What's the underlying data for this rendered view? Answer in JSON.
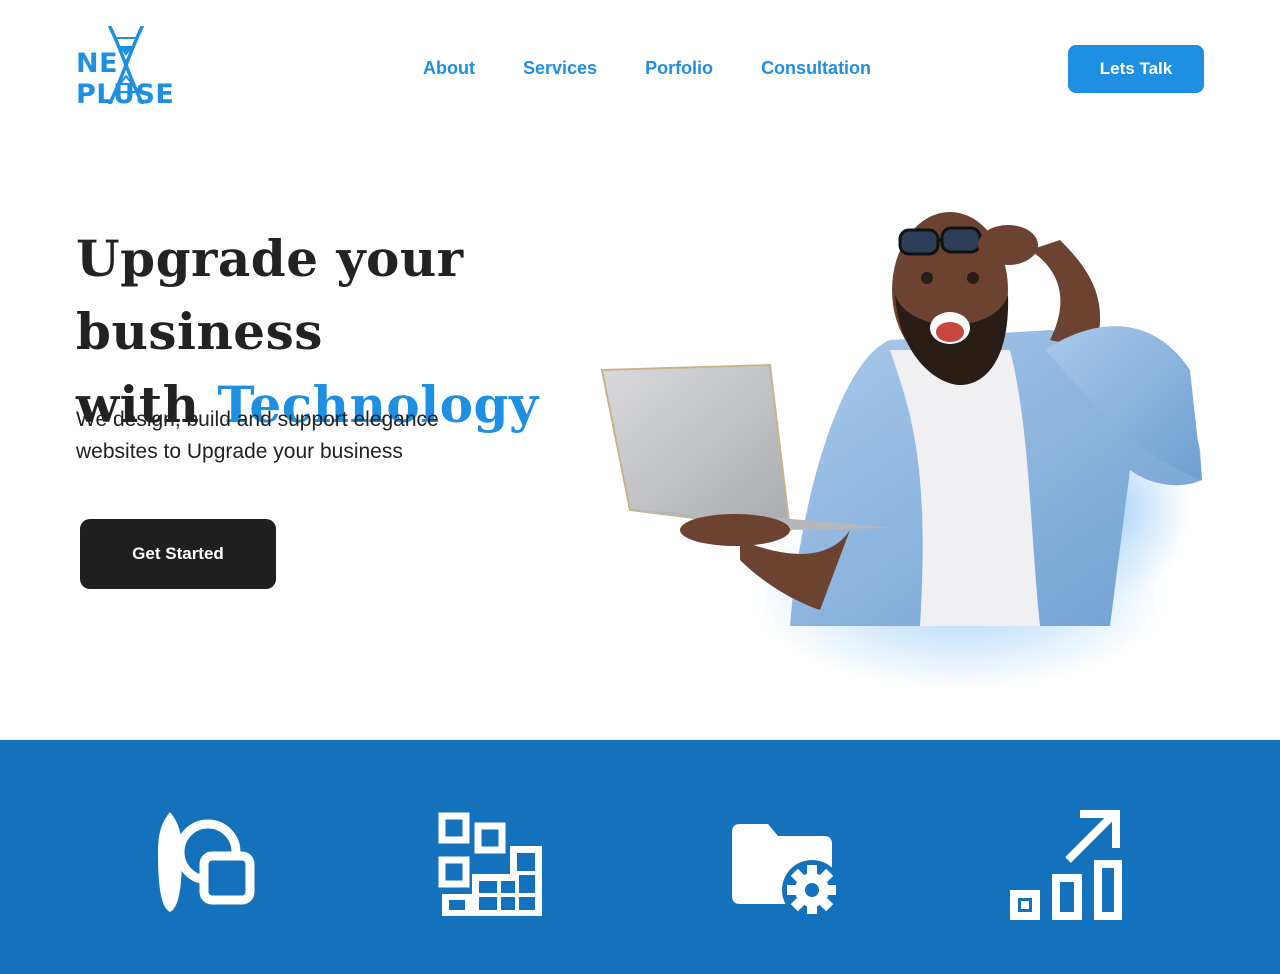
{
  "brand": {
    "logo_text_left": "NE",
    "logo_text_right": "PLUSE",
    "color": "#1e8fe1"
  },
  "nav": {
    "items": [
      {
        "label": "About"
      },
      {
        "label": "Services"
      },
      {
        "label": "Porfolio"
      },
      {
        "label": "Consultation"
      }
    ],
    "cta_label": "Lets Talk"
  },
  "hero": {
    "title_line1": "Upgrade your business",
    "title_with": "with",
    "title_accent": "Technology",
    "subtitle": "We design, build and support elegance websites to Upgrade your business",
    "cta_label": "Get Started",
    "image": "smiling-man-with-laptop-photo"
  },
  "services": {
    "background": "#1472bd",
    "icons": [
      "design-tools-icon",
      "grid-blocks-icon",
      "folder-settings-icon",
      "growth-chart-icon"
    ]
  },
  "colors": {
    "accent": "#1e8fe1",
    "dark": "#1f1f1f",
    "band": "#1472bd"
  }
}
